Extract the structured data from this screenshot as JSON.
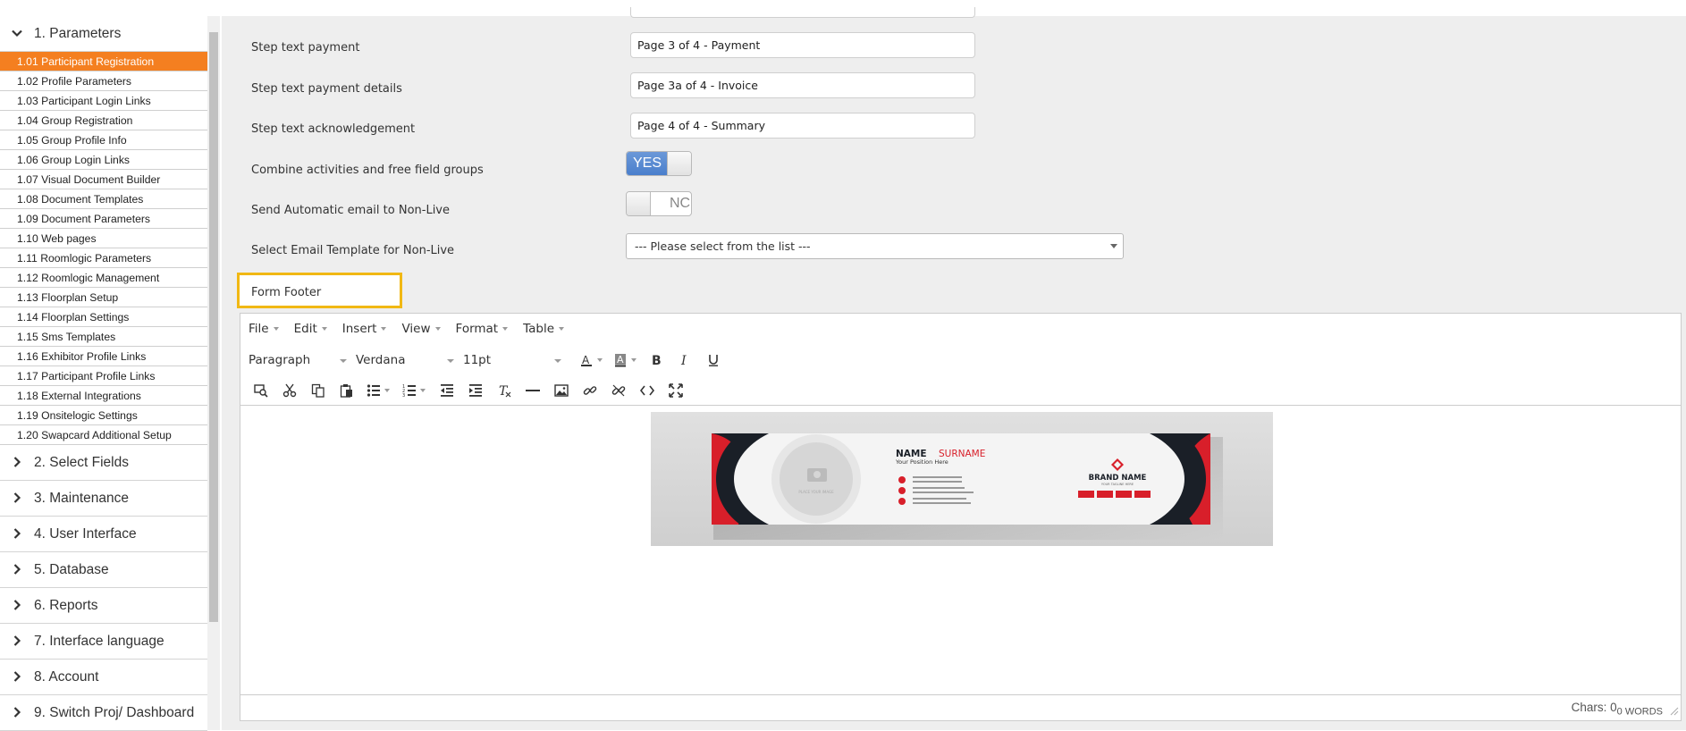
{
  "sidebar": {
    "sections": [
      {
        "label": "1. Parameters",
        "expanded": true
      },
      {
        "label": "2. Select Fields"
      },
      {
        "label": "3. Maintenance"
      },
      {
        "label": "4. User Interface"
      },
      {
        "label": "5. Database"
      },
      {
        "label": "6. Reports"
      },
      {
        "label": "7. Interface language"
      },
      {
        "label": "8. Account"
      },
      {
        "label": "9. Switch Proj/ Dashboard"
      }
    ],
    "items": [
      "1.01 Participant Registration",
      "1.02 Profile Parameters",
      "1.03 Participant Login Links",
      "1.04 Group Registration",
      "1.05 Group Profile Info",
      "1.06 Group Login Links",
      "1.07 Visual Document Builder",
      "1.08 Document Templates",
      "1.09 Document Parameters",
      "1.10 Web pages",
      "1.11 Roomlogic Parameters",
      "1.12 Roomlogic Management",
      "1.13 Floorplan Setup",
      "1.14 Floorplan Settings",
      "1.15 Sms Templates",
      "1.16 Exhibitor Profile Links",
      "1.17 Participant Profile Links",
      "1.18 External Integrations",
      "1.19 Onsitelogic Settings",
      "1.20 Swapcard Additional Setup"
    ],
    "active_item": "1.01 Participant Registration",
    "active_color": "#f47f20"
  },
  "form": {
    "payment": {
      "label": "Step text payment",
      "value": "Page 3 of 4 - Payment"
    },
    "payment_details": {
      "label": "Step text payment details",
      "value": "Page 3a of 4 - Invoice"
    },
    "acknowledgement": {
      "label": "Step text acknowledgement",
      "value": "Page 4 of 4 - Summary"
    },
    "combine": {
      "label": "Combine activities and free field groups",
      "toggle": "YES",
      "state": "on"
    },
    "send_email": {
      "label": "Send Automatic email to Non-Live",
      "toggle": "NC",
      "state": "off"
    },
    "email_template": {
      "label": "Select Email Template for Non-Live",
      "value": "--- Please select from the list ---"
    },
    "footer": {
      "label": "Form Footer",
      "highlight_color": "#f1b814"
    }
  },
  "editor": {
    "menus": [
      "File",
      "Edit",
      "Insert",
      "View",
      "Format",
      "Table"
    ],
    "block_format": "Paragraph",
    "font_family": "Verdana",
    "font_size": "11pt",
    "toolbar1_icons": [
      "text-color-icon",
      "background-color-icon",
      "bold-icon",
      "italic-icon",
      "underline-icon"
    ],
    "toolbar2_icons": [
      "find-replace-icon",
      "cut-icon",
      "copy-icon",
      "paste-icon",
      "bullet-list-icon",
      "numbered-list-icon",
      "outdent-icon",
      "indent-icon",
      "clear-format-icon",
      "horizontal-rule-icon",
      "image-icon",
      "link-icon",
      "unlink-icon",
      "source-code-icon",
      "fullscreen-icon"
    ],
    "status": {
      "chars_label": "Chars: 0",
      "words_label": "0 WORDS"
    },
    "card": {
      "name_first": "NAME",
      "name_last": "SURNAME",
      "position": "Your Position Here",
      "photo_placeholder": "PLACE YOUR IMAGE",
      "brand_name": "BRAND NAME",
      "brand_tagline": "YOUR TAGLINE HERE",
      "accent_color": "#d81f2a",
      "dark_color": "#1a1f27"
    }
  }
}
